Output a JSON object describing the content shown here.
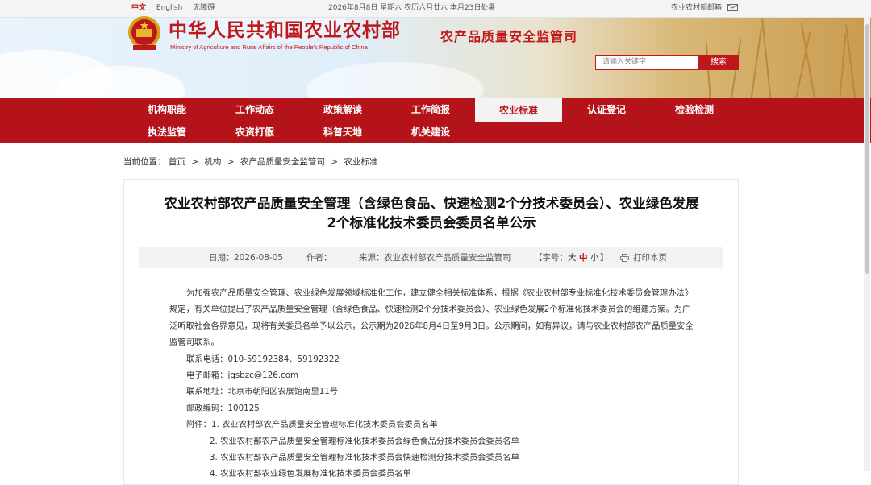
{
  "topbar": {
    "lang_cn": "中文",
    "lang_en": "English",
    "accessibility": "无障碍",
    "date": "2026年8月8日 星期六 农历六月廿六 本月23日处暑",
    "mail": "农业农村部邮箱"
  },
  "header": {
    "title": "中华人民共和国农业农村部",
    "subtitle": "Ministry of Agriculture and Rural Affairs of the People's Republic of China",
    "dept": "农产品质量安全监管司",
    "search_placeholder": "请输入关键字",
    "search_button": "搜索"
  },
  "nav": {
    "row1": [
      "机构职能",
      "工作动态",
      "政策解读",
      "工作简报",
      "农业标准",
      "认证登记",
      "检验检测"
    ],
    "row2": [
      "执法监管",
      "农资打假",
      "科普天地",
      "机关建设"
    ],
    "active": "农业标准"
  },
  "breadcrumb": {
    "label": "当前位置：",
    "items": [
      "首页",
      ">",
      "机构",
      ">",
      "农产品质量安全监管司",
      ">",
      "农业标准"
    ]
  },
  "article": {
    "title_line1": "农业农村部农产品质量安全管理（含绿色食品、快速检测2个分技术委员会）、农业绿色发展",
    "title_line2": "2个标准化技术委员会委员名单公示",
    "meta": {
      "date_label": "日期：",
      "date": "2026-08-05",
      "author_label": "作者：",
      "source_label": "来源：",
      "source": "农业农村部农产品质量安全监管司",
      "font_label_open": "【字号：",
      "font_big": "大",
      "font_mid": "中",
      "font_small": "小",
      "font_label_close": "】",
      "print": "打印本页"
    },
    "paragraph": "为加强农产品质量安全管理、农业绿色发展领域标准化工作，建立健全相关标准体系，根据《农业农村部专业标准化技术委员会管理办法》规定，有关单位提出了农产品质量安全管理（含绿色食品、快速检测2个分技术委员会）、农业绿色发展2个标准化技术委员会的组建方案。为广泛听取社会各界意见，现将有关委员名单予以公示，公示期为2026年8月4日至9月3日。公示期间，如有异议，请与农业农村部农产品质量安全监管司联系。",
    "contact_phone": "联系电话：010-59192384、59192322",
    "email": "电子邮箱：jgsbzc@126.com",
    "address": "联系地址：北京市朝阳区农展馆南里11号",
    "postcode": "邮政编码：100125",
    "attachments_label": "附件：",
    "attachments": [
      "1. 农业农村部农产品质量安全管理标准化技术委员会委员名单",
      "2. 农业农村部农产品质量安全管理标准化技术委员会绿色食品分技术委员会委员名单",
      "3. 农业农村部农产品质量安全管理标准化技术委员会快速检测分技术委员会委员名单",
      "4. 农业农村部农业绿色发展标准化技术委员会委员名单"
    ]
  }
}
